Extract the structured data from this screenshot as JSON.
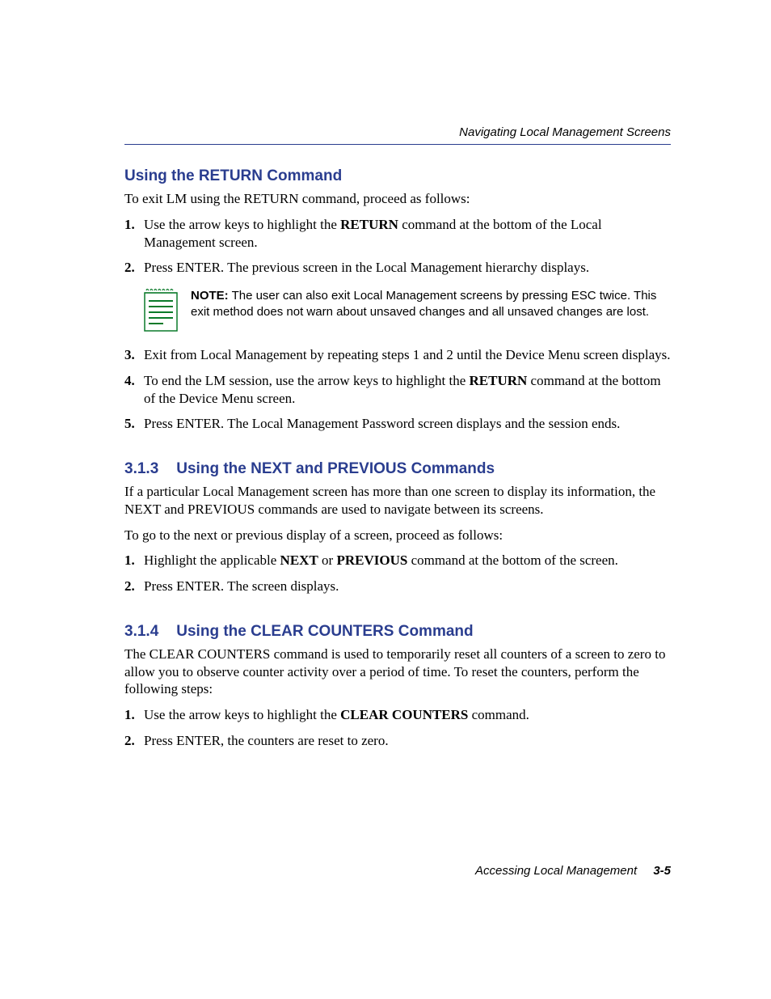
{
  "header": {
    "running": "Navigating Local Management Screens"
  },
  "section_a": {
    "title": "Using the RETURN Command",
    "intro": "To exit LM using the RETURN command, proceed as follows:",
    "step1_pre": "Use the arrow keys to highlight the ",
    "step1_bold": "RETURN",
    "step1_post": " command at the bottom of the Local Management screen.",
    "step2": "Press ENTER. The previous screen in the Local Management hierarchy displays.",
    "note_label": "NOTE:",
    "note_text": "  The user can also exit Local Management screens by pressing ESC twice. This exit method does not warn about unsaved changes and all unsaved changes are lost.",
    "step3": "Exit from Local Management by repeating steps 1 and 2 until the Device Menu screen displays.",
    "step4_pre": "To end the LM session, use the arrow keys to highlight the ",
    "step4_bold": "RETURN",
    "step4_post": " command at the bottom of the Device Menu screen.",
    "step5": "Press ENTER. The Local Management Password screen displays and the session ends."
  },
  "section_b": {
    "num": "3.1.3",
    "title": "Using the NEXT and PREVIOUS Commands",
    "p1": "If a particular Local Management screen has more than one screen to display its information, the NEXT and PREVIOUS commands are used to navigate between its screens.",
    "p2": "To go to the next or previous display of a screen, proceed as follows:",
    "step1_pre": "Highlight the applicable ",
    "step1_b1": "NEXT",
    "step1_mid": " or ",
    "step1_b2": "PREVIOUS",
    "step1_post": " command at the bottom of the screen.",
    "step2": "Press ENTER. The screen displays."
  },
  "section_c": {
    "num": "3.1.4",
    "title": "Using the CLEAR COUNTERS Command",
    "p1": "The CLEAR COUNTERS command is used to temporarily reset all counters of a screen to zero to allow you to observe counter activity over a period of time. To reset the counters, perform the following steps:",
    "step1_pre": "Use the arrow keys to highlight the ",
    "step1_bold": "CLEAR COUNTERS",
    "step1_post": " command.",
    "step2": "Press ENTER, the counters are reset to zero."
  },
  "footer": {
    "title": "Accessing Local Management",
    "page": "3-5"
  }
}
